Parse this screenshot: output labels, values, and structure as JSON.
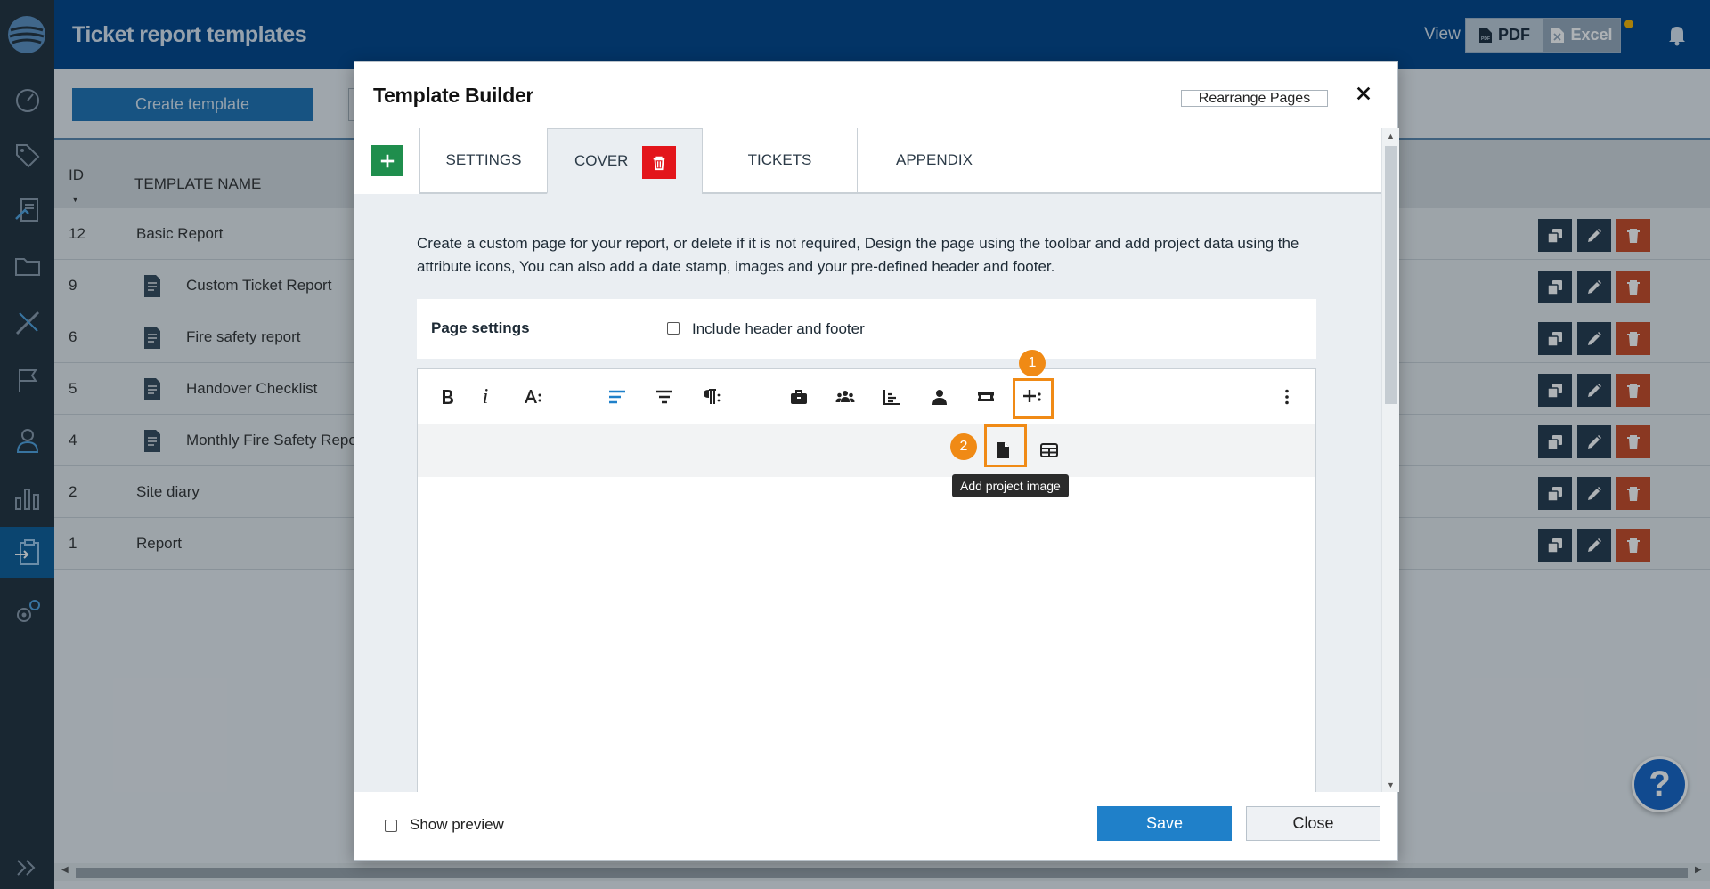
{
  "app": {
    "page_title": "Ticket report templates",
    "view_label": "View",
    "view_options": [
      "PDF",
      "Excel"
    ]
  },
  "nav": {
    "items": [
      "dashboard",
      "tags",
      "reports",
      "folders",
      "tools",
      "flags",
      "users",
      "charts",
      "templates",
      "settings"
    ],
    "active": "templates"
  },
  "background": {
    "create_button": "Create template",
    "table": {
      "headers": {
        "id": "ID",
        "name": "TEMPLATE NAME"
      },
      "rows": [
        {
          "id": "12",
          "name": "Basic Report",
          "icon": false
        },
        {
          "id": "9",
          "name": "Custom Ticket Report",
          "icon": true
        },
        {
          "id": "6",
          "name": "Fire safety report",
          "icon": true
        },
        {
          "id": "5",
          "name": "Handover Checklist",
          "icon": true
        },
        {
          "id": "4",
          "name": "Monthly Fire Safety Repo",
          "icon": true
        },
        {
          "id": "2",
          "name": "Site diary",
          "icon": false
        },
        {
          "id": "1",
          "name": "Report",
          "icon": false
        }
      ]
    }
  },
  "modal": {
    "title": "Template Builder",
    "rearrange_button": "Rearrange Pages",
    "tabs": [
      {
        "label": "SETTINGS"
      },
      {
        "label": "COVER",
        "active": true
      },
      {
        "label": "TICKETS"
      },
      {
        "label": "APPENDIX"
      }
    ],
    "description": "Create a custom page for your report, or delete if it is not required, Design the page using the toolbar and add project data using the attribute icons, You can also add a date stamp, images and your pre-defined header and footer.",
    "page_settings": {
      "label": "Page settings",
      "include_header_footer": "Include header and footer"
    },
    "toolbar": {
      "italic": "i",
      "badge_1": "1",
      "badge_2": "2",
      "tooltip": "Add project image"
    },
    "footer": {
      "show_preview": "Show preview",
      "save": "Save",
      "close": "Close"
    }
  },
  "colors": {
    "topbar": "#00448a",
    "highlight": "#f08a15",
    "save": "#1f80c9",
    "delete": "#c94a25",
    "add": "#1f8e4d"
  },
  "help": "?"
}
